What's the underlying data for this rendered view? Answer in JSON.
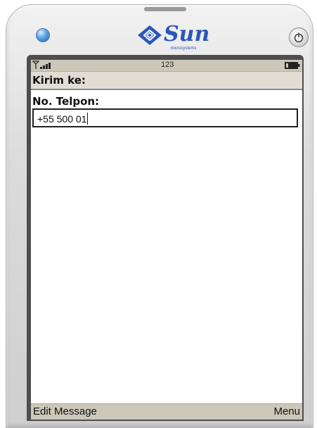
{
  "device": {
    "brand_name": "Sun",
    "brand_sub": "microsystems",
    "brand_color": "#2a57b8"
  },
  "status": {
    "signal_icon": "signal-strength-icon",
    "input_mode": "123",
    "battery_icon": "battery-icon"
  },
  "screen": {
    "title": "Kirim ke:",
    "field_label": "No. Telpon:",
    "field_value": "+55 500 01"
  },
  "softkeys": {
    "left": "Edit Message",
    "right": "Menu"
  },
  "colors": {
    "bar_background": "#ccc8b9",
    "title_background": "#e1ddd5"
  }
}
